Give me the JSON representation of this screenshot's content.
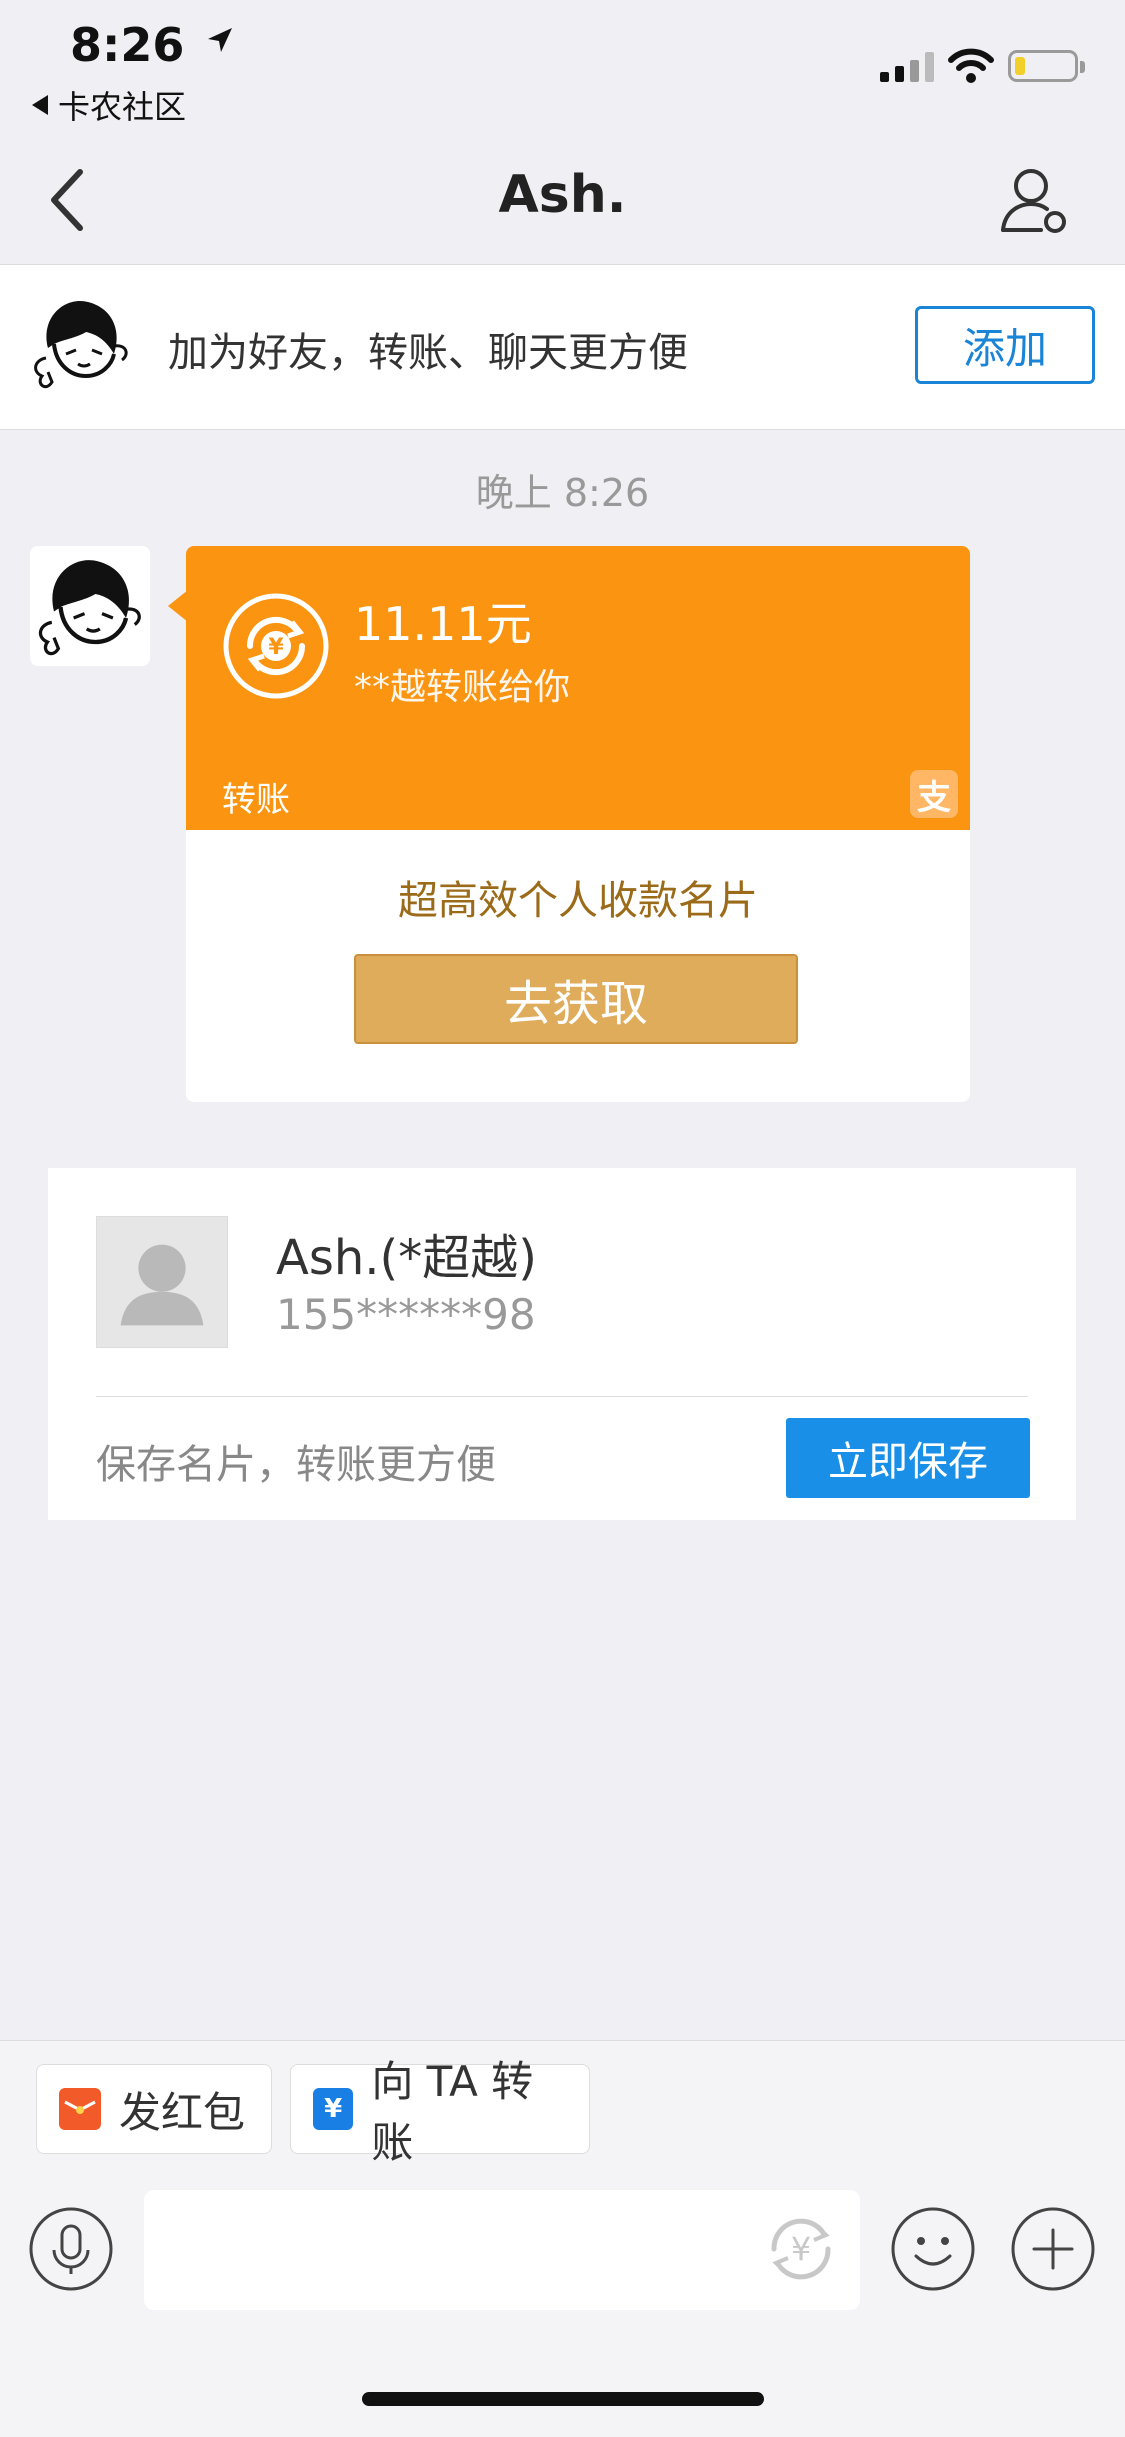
{
  "status_bar": {
    "time": "8:26",
    "back_app": "卡农社区"
  },
  "nav": {
    "title": "Ash."
  },
  "friend_bar": {
    "text": "加为好友，转账、聊天更方便",
    "add_label": "添加"
  },
  "chat": {
    "time": "晚上 8:26",
    "transfer_card": {
      "amount": "11.11元",
      "description": "**越转账给你",
      "label": "转账",
      "alipay_glyph": "支",
      "promo": "超高效个人收款名片",
      "action_label": "去获取",
      "accent_color": "#fb9511"
    },
    "contact_card": {
      "name": "Ash.(*超越)",
      "phone": "155******98",
      "hint": "保存名片，转账更方便",
      "save_label": "立即保存",
      "save_color": "#1a8fe8"
    }
  },
  "bottom": {
    "quick_actions": {
      "red_packet": {
        "label": "发红包",
        "icon": "red-packet-icon"
      },
      "transfer": {
        "label": "向 TA 转账",
        "icon": "transfer-yuan-icon",
        "glyph": "¥"
      }
    },
    "input": {
      "value": "",
      "placeholder": ""
    },
    "icons": [
      "microphone-icon",
      "yuan-transfer-icon",
      "emoji-icon",
      "plus-icon"
    ]
  }
}
